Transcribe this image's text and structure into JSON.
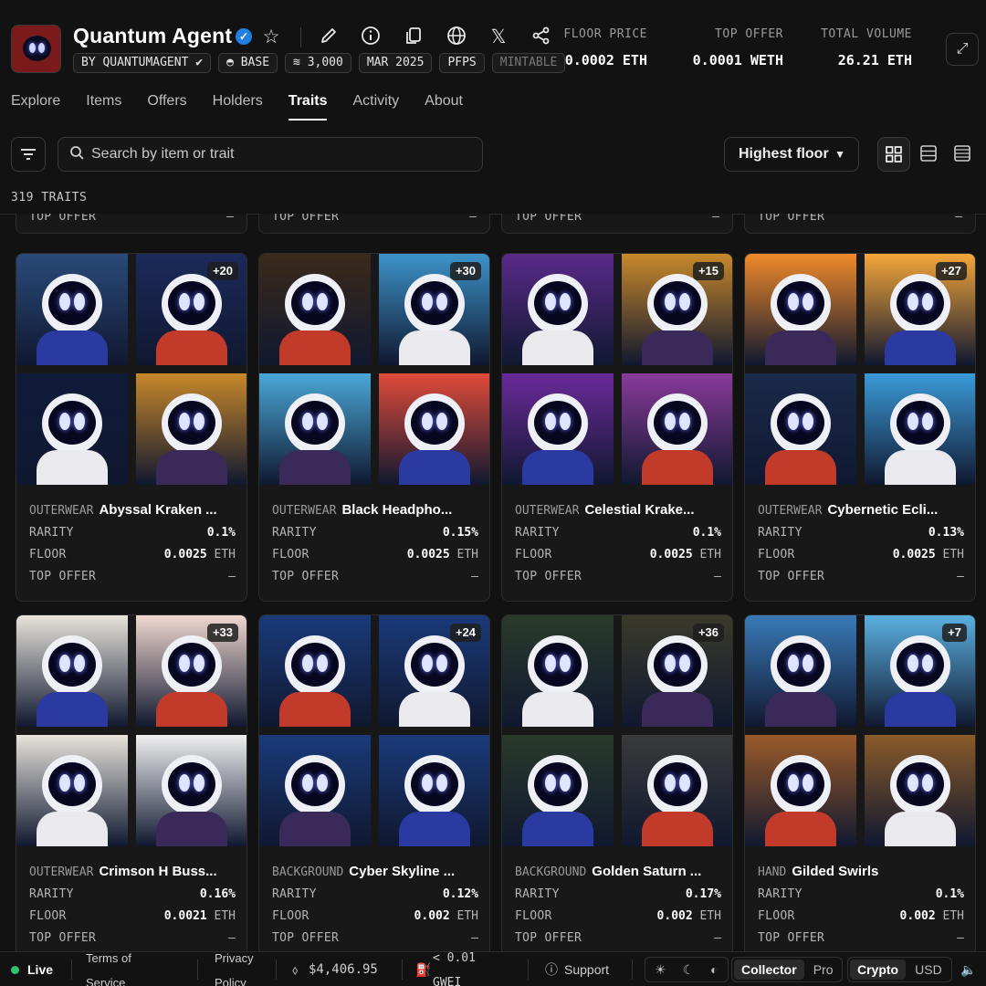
{
  "header": {
    "title": "Quantum Agent",
    "chips": [
      "BY QUANTUMAGENT",
      "BASE",
      "3,000",
      "MAR 2025",
      "PFPS",
      "MINTABLE"
    ],
    "stats": [
      {
        "label": "FLOOR PRICE",
        "value": "0.0002 ETH"
      },
      {
        "label": "TOP OFFER",
        "value": "0.0001 WETH"
      },
      {
        "label": "TOTAL VOLUME",
        "value": "26.21 ETH"
      }
    ],
    "icons": [
      "star-icon",
      "edit-icon",
      "info-icon",
      "copy-icon",
      "globe-icon",
      "x-icon",
      "share-icon",
      "expand-icon"
    ]
  },
  "tabs": [
    "Explore",
    "Items",
    "Offers",
    "Holders",
    "Traits",
    "Activity",
    "About"
  ],
  "active_tab": "Traits",
  "toolbar": {
    "search_placeholder": "Search by item or trait",
    "sort_label": "Highest floor"
  },
  "traits_count": "319 TRAITS",
  "labels": {
    "rarity": "RARITY",
    "floor": "FLOOR",
    "top_offer": "TOP OFFER",
    "dash": "–",
    "unit": "ETH"
  },
  "cards": [
    {
      "category": "OUTERWEAR",
      "name": "Abyssal Kraken ...",
      "extra": "+20",
      "rarity": "0.1%",
      "floor": "0.0025",
      "colors": [
        "#2a4a7a",
        "#1b2a5a",
        "#0f1a3a",
        "#c8882a"
      ]
    },
    {
      "category": "OUTERWEAR",
      "name": "Black Headpho...",
      "extra": "+30",
      "rarity": "0.15%",
      "floor": "0.0025",
      "colors": [
        "#3a2a1a",
        "#3c93c9",
        "#4aa8d8",
        "#e14b3a"
      ]
    },
    {
      "category": "OUTERWEAR",
      "name": "Celestial Krake...",
      "extra": "+15",
      "rarity": "0.1%",
      "floor": "0.0025",
      "colors": [
        "#5a2a8a",
        "#c8882a",
        "#6a2a9a",
        "#8a3a9a"
      ]
    },
    {
      "category": "OUTERWEAR",
      "name": "Cybernetic Ecli...",
      "extra": "+27",
      "rarity": "0.13%",
      "floor": "0.0025",
      "colors": [
        "#f08a2a",
        "#f4a63a",
        "#1a2a4a",
        "#3a9ad8"
      ]
    },
    {
      "category": "OUTERWEAR",
      "name": "Crimson H Buss...",
      "extra": "+33",
      "rarity": "0.16%",
      "floor": "0.0021",
      "colors": [
        "#e8e4dc",
        "#f1d8d0",
        "#e8e4dc",
        "#f0f0f0"
      ]
    },
    {
      "category": "BACKGROUND",
      "name": "Cyber Skyline ...",
      "extra": "+24",
      "rarity": "0.12%",
      "floor": "0.002",
      "colors": [
        "#1a3a7a",
        "#1a3a7a",
        "#1a3a7a",
        "#1a3a7a"
      ]
    },
    {
      "category": "BACKGROUND",
      "name": "Golden Saturn ...",
      "extra": "+36",
      "rarity": "0.17%",
      "floor": "0.002",
      "colors": [
        "#2a3a2a",
        "#3a3a2a",
        "#2a3a2a",
        "#3a3a3a"
      ]
    },
    {
      "category": "HAND",
      "name": "Gilded Swirls",
      "extra": "+7",
      "rarity": "0.1%",
      "floor": "0.002",
      "colors": [
        "#3a7ab8",
        "#5ab0e0",
        "#9a5a2a",
        "#8a5a2a"
      ]
    }
  ],
  "footer": {
    "live": "Live",
    "terms": "Terms of Service",
    "privacy": "Privacy Policy",
    "eth_price": "$4,406.95",
    "gas": "< 0.01 GWEI",
    "support": "Support",
    "mode_options": [
      "Collector",
      "Pro"
    ],
    "mode_active": "Collector",
    "currency_options": [
      "Crypto",
      "USD"
    ],
    "currency_active": "Crypto"
  }
}
